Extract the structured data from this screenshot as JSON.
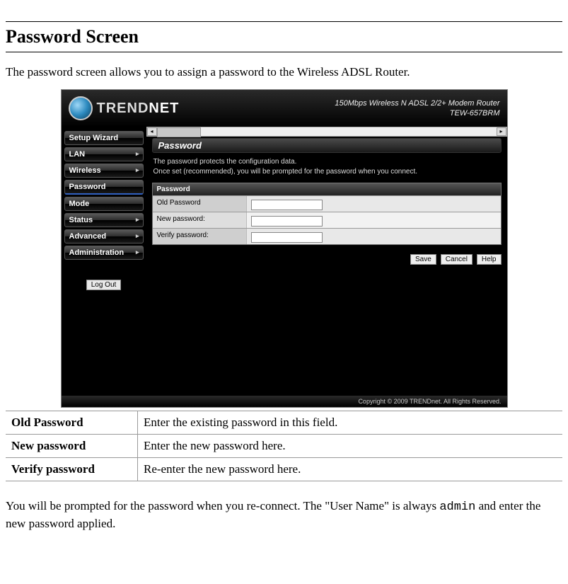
{
  "page": {
    "title": "Password Screen",
    "intro": "The password screen allows you to assign a password to the Wireless ADSL Router."
  },
  "router_ui": {
    "brand": "TRENDNET",
    "model_line1": "150Mbps Wireless N ADSL 2/2+ Modem Router",
    "model_line2": "TEW-657BRM",
    "nav": [
      "Setup Wizard",
      "LAN",
      "Wireless",
      "Password",
      "Mode",
      "Status",
      "Advanced",
      "Administration"
    ],
    "logout": "Log Out",
    "panel_title": "Password",
    "panel_desc1": "The password protects the configuration data.",
    "panel_desc2": "Once set (recommended), you will be prompted for the password when you connect.",
    "form_header": "Password",
    "fields": {
      "old": "Old Password",
      "new": "New password:",
      "verify": "Verify password:"
    },
    "buttons": {
      "save": "Save",
      "cancel": "Cancel",
      "help": "Help"
    },
    "copyright": "Copyright © 2009 TRENDnet. All Rights Reserved."
  },
  "desc_table": [
    {
      "k": "Old Password",
      "v": "Enter the existing password in this field."
    },
    {
      "k": "New password",
      "v": "Enter the new password here."
    },
    {
      "k": "Verify password",
      "v": "Re-enter the new password here."
    }
  ],
  "outro": {
    "pre": "You will be prompted for the password when you re-connect. The \"User Name\" is always ",
    "code": "admin",
    "post": " and enter the new password applied."
  }
}
